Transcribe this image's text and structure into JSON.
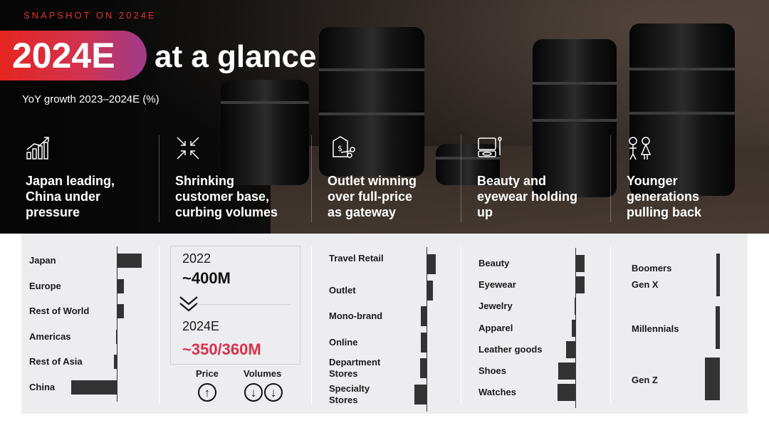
{
  "header": {
    "kicker": "SNAPSHOT ON 2024E",
    "title_highlight": "2024E",
    "title_rest": "at a glance",
    "subtitle": "YoY growth 2023–2024E (%)"
  },
  "columns": [
    {
      "icon": "bar-chart-growth-icon",
      "heading": [
        "Japan leading,",
        "China under",
        "pressure"
      ]
    },
    {
      "icon": "shrink-arrows-icon",
      "heading": [
        "Shrinking",
        "customer base,",
        "curbing volumes"
      ]
    },
    {
      "icon": "price-tag-scissors-icon",
      "heading": [
        "Outlet winning",
        "over full-price",
        "as gateway"
      ]
    },
    {
      "icon": "makeup-palette-icon",
      "heading": [
        "Beauty and",
        "eyewear holding",
        "up"
      ]
    },
    {
      "icon": "boy-girl-icon",
      "heading": [
        "Younger",
        "generations",
        "pulling back"
      ]
    }
  ],
  "customer_base": {
    "year_1": "2022",
    "value_1": "~400M",
    "year_2": "2024E",
    "value_2": "~350/360M",
    "price_label": "Price",
    "volumes_label": "Volumes",
    "value_2_color": "#d6304e"
  },
  "chart_data": [
    {
      "type": "bar",
      "orientation": "horizontal",
      "group": "regions",
      "categories": [
        "Japan",
        "Europe",
        "Rest of World",
        "Americas",
        "Rest of Asia",
        "China"
      ],
      "values": [
        35,
        10,
        10,
        -1,
        -4,
        -64
      ]
    },
    {
      "type": "bar",
      "orientation": "horizontal",
      "group": "channels",
      "categories": [
        "Travel Retail",
        "Outlet",
        "Mono-brand",
        "Online",
        "Department Stores",
        "Specialty Stores"
      ],
      "values": [
        13,
        9,
        -8,
        -8,
        -9,
        -17
      ]
    },
    {
      "type": "bar",
      "orientation": "horizontal",
      "group": "categories",
      "categories": [
        "Beauty",
        "Eyewear",
        "Jewelry",
        "Apparel",
        "Leather goods",
        "Shoes",
        "Watches"
      ],
      "values": [
        13,
        13,
        -1,
        -5,
        -13,
        -24,
        -25
      ]
    },
    {
      "type": "bar",
      "orientation": "horizontal",
      "group": "generations",
      "categories": [
        "Boomers",
        "Gen X",
        "Millennials",
        "Gen Z"
      ],
      "values": [
        -5,
        -5,
        -6,
        -21
      ]
    }
  ]
}
